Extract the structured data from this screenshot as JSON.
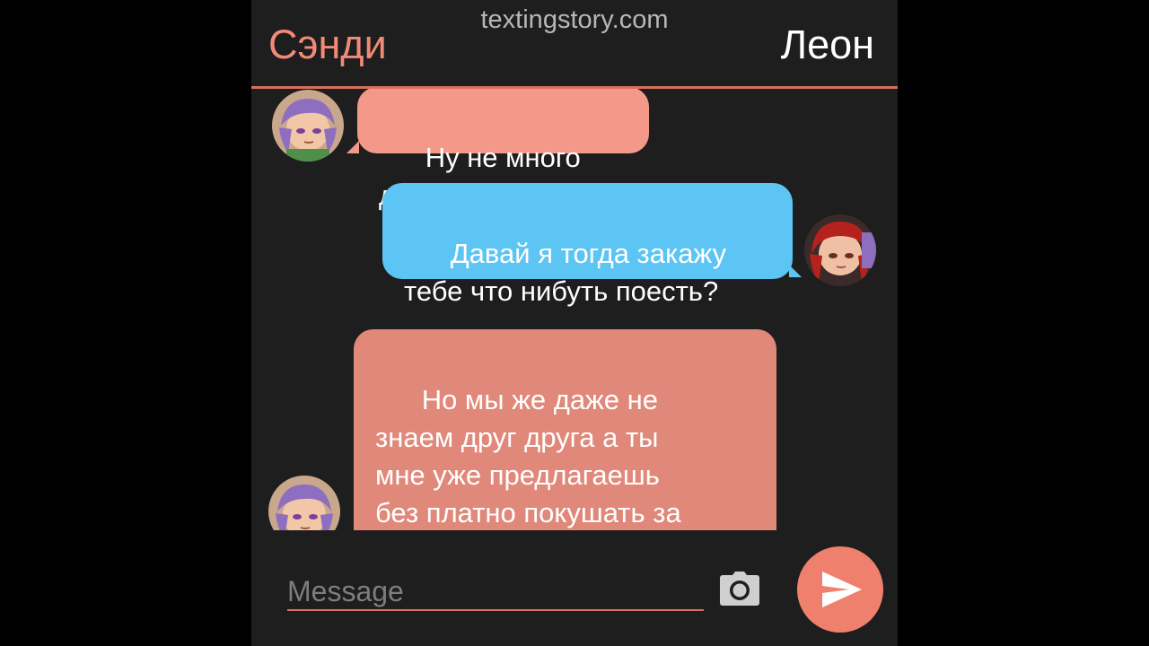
{
  "watermark": "textingstory.com",
  "header": {
    "left_contact": "Сэнди",
    "right_contact": "Леон"
  },
  "messages": [
    {
      "sender": "Сэнди",
      "text": "Ну не много да.."
    },
    {
      "sender": "Леон",
      "text": "Давай я тогда закажу\nтебе что нибуть поесть?"
    },
    {
      "sender": "Сэнди",
      "text": "Но мы же даже не\nзнаем друг друга а ты\nмне уже предлагаешь\nбез платно покушать за\nтвой же счёт"
    }
  ],
  "input": {
    "placeholder": "Message"
  },
  "icons": {
    "camera": "camera-icon",
    "send": "send-icon"
  },
  "colors": {
    "accent": "#f0806e",
    "sandy_bubble": "#f4998a",
    "leon_bubble": "#5cc5f4",
    "background": "#1e1e1e"
  }
}
